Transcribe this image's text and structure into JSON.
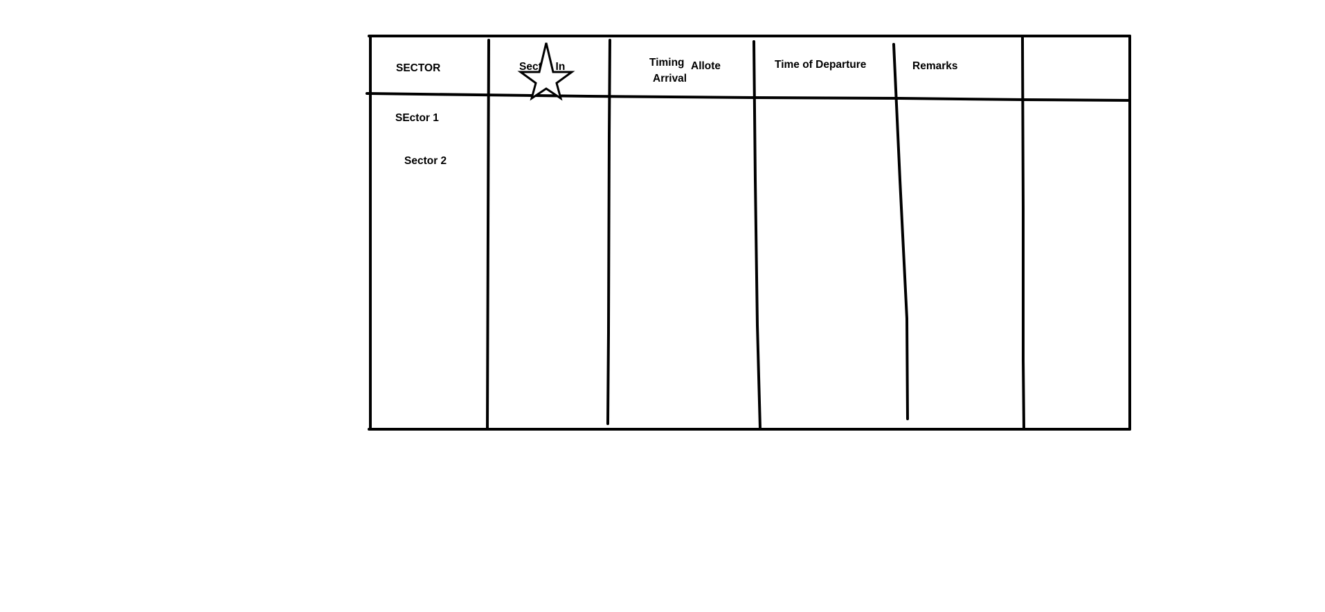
{
  "table": {
    "headers": {
      "sector": "SECTOR",
      "sector_in": "Sector In",
      "timing": "Timing",
      "allote": "Allote",
      "arrival": "Arrival",
      "departure": "Time of Departure",
      "remarks": "Remarks",
      "extra": ""
    },
    "rows": [
      {
        "sector": "SEctor 1"
      },
      {
        "sector": "Sector 2"
      }
    ]
  },
  "annotations": {
    "star_icon": "star-icon"
  },
  "colors": {
    "ink": "#000000",
    "background": "#ffffff"
  }
}
